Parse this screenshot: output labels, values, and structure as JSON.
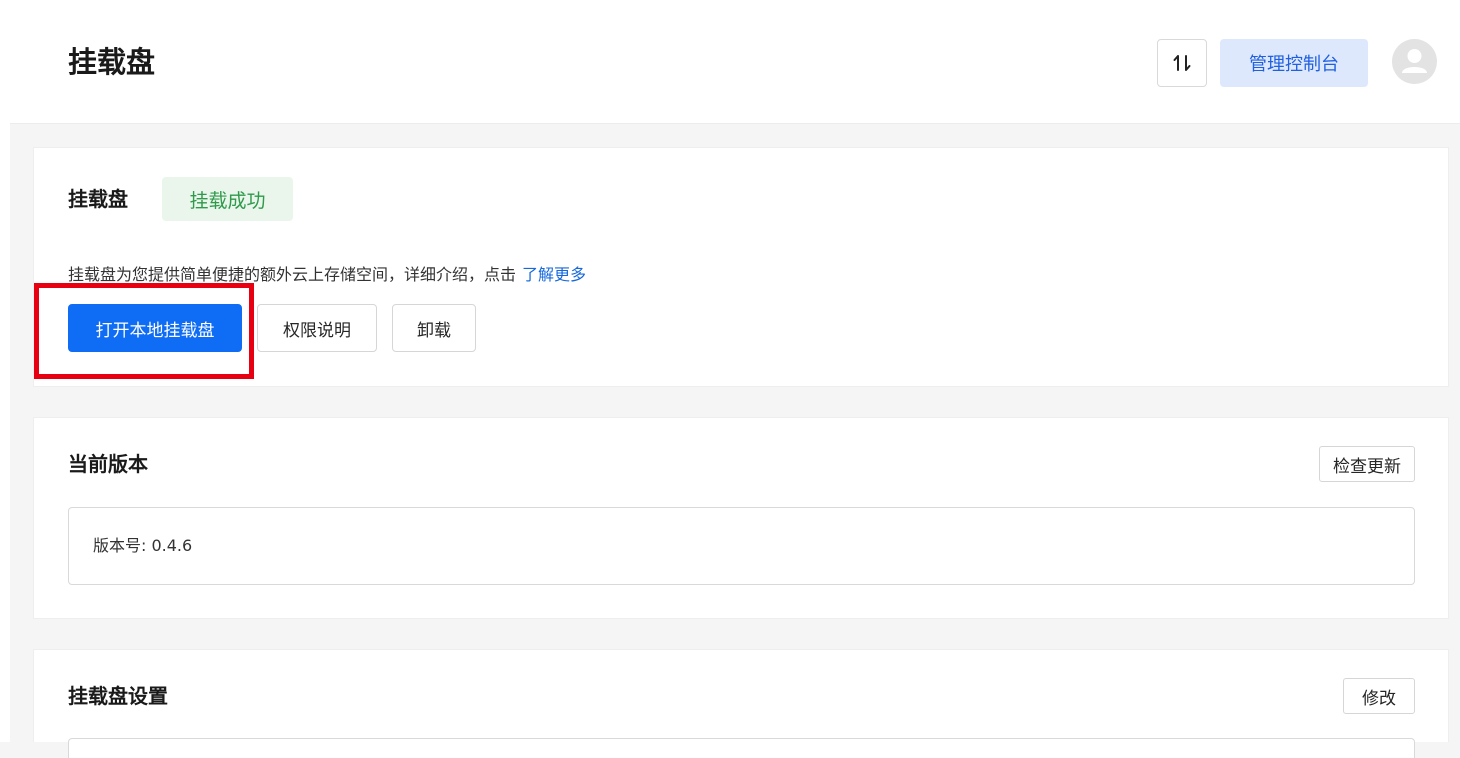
{
  "header": {
    "title": "挂载盘",
    "sort_icon_glyph": "⇅",
    "console_label": "管理控制台"
  },
  "mount_card": {
    "title": "挂载盘",
    "status": "挂载成功",
    "description": "挂载盘为您提供简单便捷的额外云上存储空间，详细介绍，点击",
    "learn_more": "了解更多",
    "open_button": "打开本地挂载盘",
    "permissions_button": "权限说明",
    "unmount_button": "卸载"
  },
  "version_card": {
    "title": "当前版本",
    "check_update_button": "检查更新",
    "version_text": "版本号: 0.4.6"
  },
  "settings_card": {
    "title": "挂载盘设置",
    "modify_button": "修改"
  },
  "colors": {
    "primary": "#0f6cf5",
    "success_text": "#2f9a4a",
    "success_bg": "#eaf6ec",
    "highlight": "#e60012",
    "console_bg": "#dde8fd"
  },
  "icons": {
    "sort": "sort-arrows-icon",
    "avatar": "user-avatar-icon"
  }
}
